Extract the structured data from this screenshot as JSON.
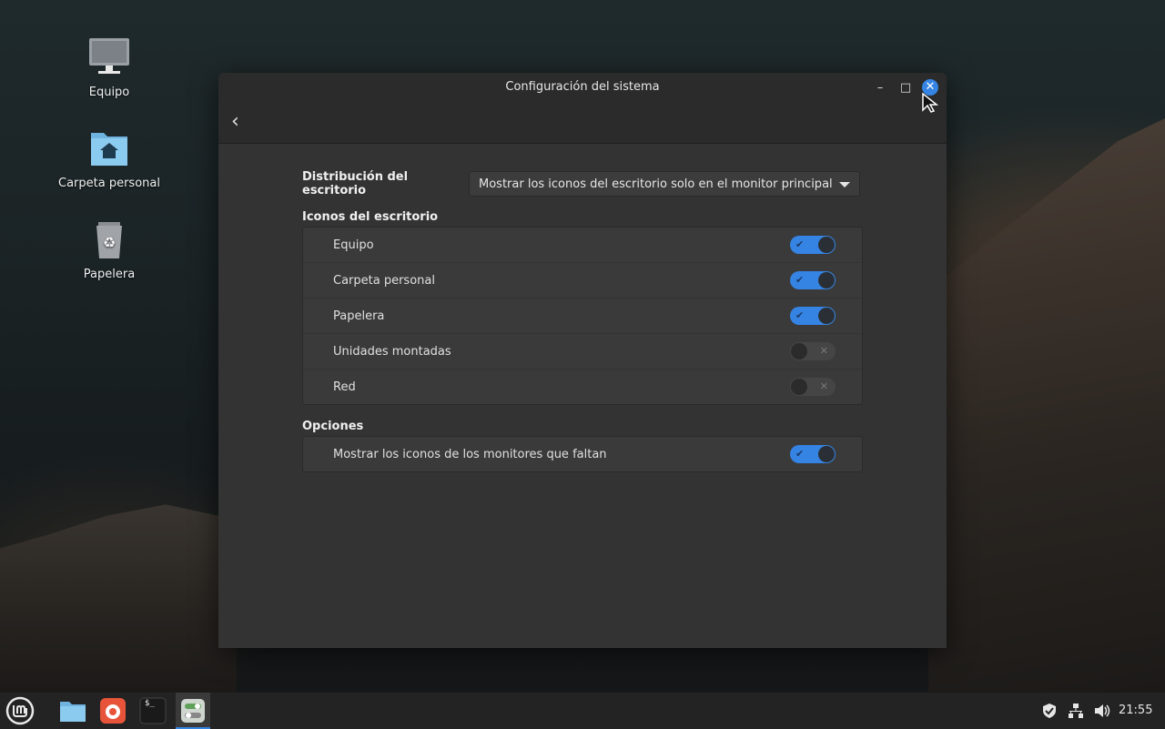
{
  "desktop": {
    "icons": [
      {
        "label": "Equipo",
        "icon": "computer-icon"
      },
      {
        "label": "Carpeta personal",
        "icon": "home-folder-icon"
      },
      {
        "label": "Papelera",
        "icon": "trash-icon"
      }
    ]
  },
  "window": {
    "title": "Configuración del sistema",
    "minimize_glyph": "–",
    "maximize_glyph": "□",
    "close_glyph": "✕",
    "back_glyph": "‹"
  },
  "settings": {
    "layout_label": "Distribución del escritorio",
    "layout_value": "Mostrar los iconos del escritorio solo en el monitor principal",
    "desktop_icons_title": "Iconos del escritorio",
    "desktop_icons": [
      {
        "label": "Equipo",
        "enabled": true
      },
      {
        "label": "Carpeta personal",
        "enabled": true
      },
      {
        "label": "Papelera",
        "enabled": true
      },
      {
        "label": "Unidades montadas",
        "enabled": false
      },
      {
        "label": "Red",
        "enabled": false
      }
    ],
    "options_title": "Opciones",
    "options": [
      {
        "label": "Mostrar los iconos de los monitores que faltan",
        "enabled": true
      }
    ]
  },
  "taskbar": {
    "apps": [
      "mint-menu-icon",
      "files-icon",
      "firefox-icon",
      "terminal-icon",
      "system-settings-icon"
    ],
    "terminal_prompt": "$_",
    "clock": "21:55"
  },
  "colors": {
    "accent": "#3584e4",
    "window_bg": "#333333",
    "panel_bg": "#3a3a3a"
  }
}
